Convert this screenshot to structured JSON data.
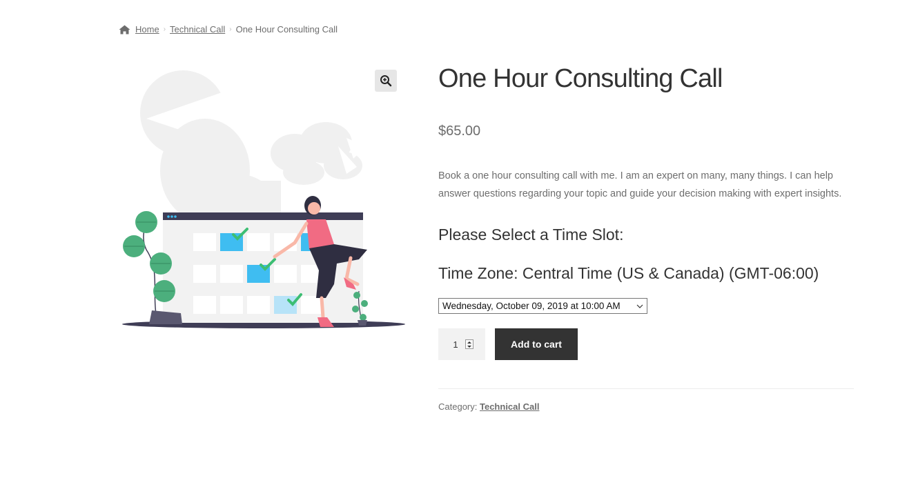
{
  "breadcrumb": {
    "home": "Home",
    "category": "Technical Call",
    "current": "One Hour Consulting Call"
  },
  "product": {
    "title": "One Hour Consulting Call",
    "price": "$65.00",
    "description": "Book a one hour consulting call with me. I am an expert on many, many things. I can help answer questions regarding your topic and guide your decision making with expert insights."
  },
  "booking": {
    "select_heading": "Please Select a Time Slot:",
    "timezone_heading": "Time Zone: Central Time (US & Canada) (GMT-06:00)",
    "selected_slot": "Wednesday, October 09, 2019 at 10:00 AM",
    "quantity": "1",
    "add_to_cart": "Add to cart"
  },
  "meta": {
    "category_label": "Category:",
    "category_link": "Technical Call"
  },
  "colors": {
    "accent_blue": "#3fbdf1",
    "check_green": "#3dbe73",
    "person_pink": "#f16b83",
    "dark_ink": "#3f3d56",
    "plant_green": "#4caf7d",
    "button_dark": "#333333"
  },
  "icons": {
    "home": "home-icon",
    "zoom": "zoom-in-icon",
    "separator": "chevron-right-icon",
    "select": "chevron-down-icon",
    "spinner": "spinner-arrows-icon"
  }
}
